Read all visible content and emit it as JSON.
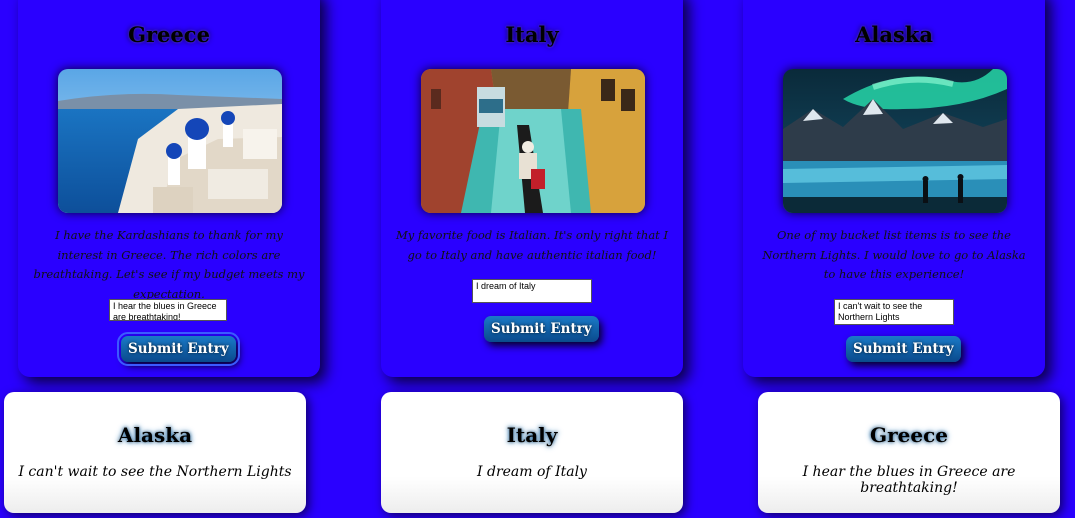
{
  "cards": [
    {
      "title": "Greece",
      "image": "santorini-photo",
      "description": "I have the Kardashians to thank for my interest in Greece. The rich colors are breathtaking. Let's see if my budget meets my expectation.",
      "entry_value": "I hear the blues in Greece are breathtaking!",
      "button_label": "Submit Entry"
    },
    {
      "title": "Italy",
      "image": "venice-canal-photo",
      "description": "My favorite food is Italian. It's only right that I go to Italy and have authentic italian food!",
      "entry_value": "I dream of Italy",
      "button_label": "Submit Entry"
    },
    {
      "title": "Alaska",
      "image": "northern-lights-photo",
      "description": "One of my bucket list items is to see the Northern Lights. I would love to go to Alaska to have this experience!",
      "entry_value": "I can't wait to see the Northern Lights",
      "button_label": "Submit Entry"
    }
  ],
  "results": [
    {
      "title": "Alaska",
      "text": "I can't wait to see the Northern Lights"
    },
    {
      "title": "Italy",
      "text": "I dream of Italy"
    },
    {
      "title": "Greece",
      "text": "I hear the blues in Greece are breathtaking!"
    }
  ],
  "colors": {
    "page_bg": "#2a00ff",
    "button": "#0a5aa8",
    "result_bg": "#ffffff"
  }
}
